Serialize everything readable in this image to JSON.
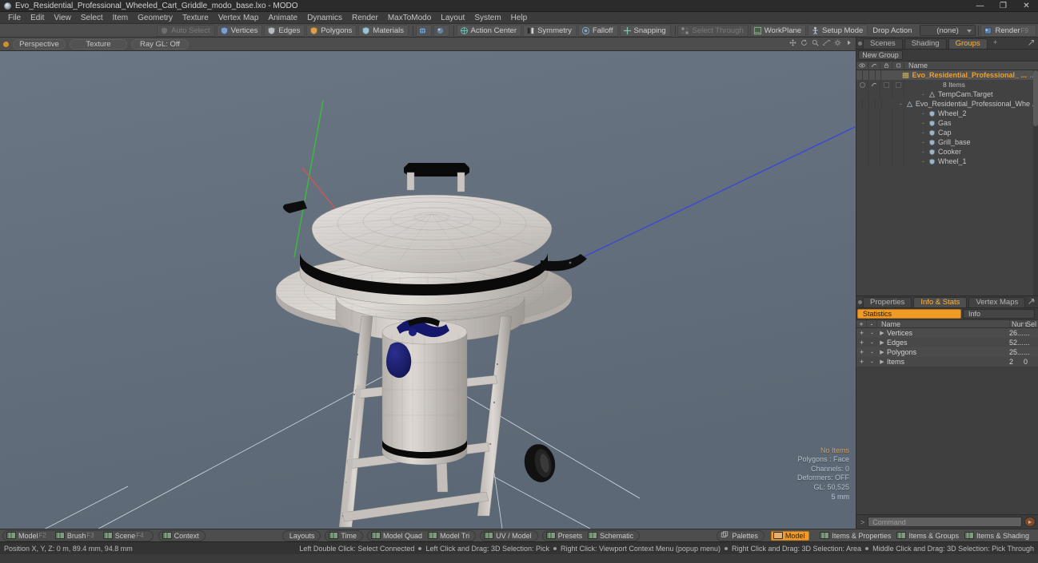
{
  "window": {
    "title": "Evo_Residential_Professional_Wheeled_Cart_Griddle_modo_base.lxo - MODO",
    "minimize": "—",
    "maximize": "❐",
    "close": "✕"
  },
  "menubar": {
    "items": [
      "File",
      "Edit",
      "View",
      "Select",
      "Item",
      "Geometry",
      "Texture",
      "Vertex Map",
      "Animate",
      "Dynamics",
      "Render",
      "MaxToModo",
      "Layout",
      "System",
      "Help"
    ]
  },
  "toolbar": {
    "auto_select": "Auto Select",
    "vertices": "Vertices",
    "edges": "Edges",
    "polygons": "Polygons",
    "materials": "Materials",
    "action_center": "Action Center",
    "symmetry": "Symmetry",
    "falloff": "Falloff",
    "snapping": "Snapping",
    "select_through": "Select Through",
    "workplane": "WorkPlane",
    "setup_mode": "Setup Mode",
    "drop_action_label": "Drop Action",
    "drop_action_value": "(none)",
    "render": "Render",
    "render_key": "F9"
  },
  "viewport": {
    "mode": "Perspective",
    "shading": "Texture",
    "raygl": "Ray GL: Off",
    "overlay": {
      "no_items": "No Items",
      "polygons": "Polygons : Face",
      "channels": "Channels: 0",
      "deformers": "Deformers: OFF",
      "gl": "GL: 50,525",
      "scale": "5 mm"
    }
  },
  "right_panel": {
    "tabs": [
      {
        "label": "Scenes",
        "active": false
      },
      {
        "label": "Shading",
        "active": false
      },
      {
        "label": "Groups",
        "active": true
      },
      {
        "label": "+",
        "active": false
      }
    ],
    "new_group_button": "New Group",
    "tree_header": {
      "name": "Name"
    },
    "tree": [
      {
        "label": "Evo_Residential_Professional_ ...",
        "kind": "group",
        "selected": true,
        "indent": 0,
        "orange": true
      },
      {
        "label": "8 Items",
        "kind": "count",
        "selected": false,
        "indent": 1,
        "orange": false
      },
      {
        "label": "TempCam.Target",
        "kind": "locator",
        "selected": false,
        "indent": 1,
        "orange": false
      },
      {
        "label": "Evo_Residential_Professional_Whe ...",
        "kind": "locator",
        "selected": false,
        "indent": 1,
        "orange": false
      },
      {
        "label": "Wheel_2",
        "kind": "mesh",
        "selected": false,
        "indent": 1,
        "orange": false
      },
      {
        "label": "Gas",
        "kind": "mesh",
        "selected": false,
        "indent": 1,
        "orange": false
      },
      {
        "label": "Cap",
        "kind": "mesh",
        "selected": false,
        "indent": 1,
        "orange": false
      },
      {
        "label": "Grill_base",
        "kind": "mesh",
        "selected": false,
        "indent": 1,
        "orange": false
      },
      {
        "label": "Cooker",
        "kind": "mesh",
        "selected": false,
        "indent": 1,
        "orange": false
      },
      {
        "label": "Wheel_1",
        "kind": "mesh",
        "selected": false,
        "indent": 1,
        "orange": false
      }
    ]
  },
  "stats_panel": {
    "tabs": [
      {
        "label": "Properties",
        "active": false
      },
      {
        "label": "Info & Stats",
        "active": true
      },
      {
        "label": "Vertex Maps",
        "active": false
      },
      {
        "label": "+",
        "active": false
      }
    ],
    "subtabs": [
      {
        "label": "Statistics",
        "active": true
      },
      {
        "label": "Info",
        "active": false
      }
    ],
    "columns": {
      "plus": "+",
      "minus": "-",
      "name": "Name",
      "num": "Num",
      "sel": "Sel"
    },
    "rows": [
      {
        "name": "Vertices",
        "num": "26...",
        "sel": "..."
      },
      {
        "name": "Edges",
        "num": "52...",
        "sel": "..."
      },
      {
        "name": "Polygons",
        "num": "25...",
        "sel": "..."
      },
      {
        "name": "Items",
        "num": "2",
        "sel": "0"
      }
    ]
  },
  "command_bar": {
    "placeholder": "Command",
    "submit": "▸"
  },
  "bottom_bar": {
    "left_group": [
      {
        "label": "Model",
        "fkey": "F2",
        "active": false
      },
      {
        "label": "Brush",
        "fkey": "F3",
        "active": false
      },
      {
        "label": "Scene",
        "fkey": "F4",
        "active": false
      }
    ],
    "context": "Context",
    "center": [
      {
        "label": "Layouts",
        "icon": false
      },
      {
        "label": "Time",
        "icon": true
      },
      {
        "label": "Model Quad",
        "icon": true
      },
      {
        "label": "Model Tri",
        "icon": true
      },
      {
        "label": "UV / Model",
        "icon": true
      },
      {
        "label": "Presets",
        "icon": true
      },
      {
        "label": "Schematic",
        "icon": true
      }
    ],
    "right": [
      {
        "label": "Palettes",
        "active": false
      },
      {
        "label": "Model",
        "active": true
      },
      {
        "label": "Items & Properties",
        "active": false
      },
      {
        "label": "Items & Groups",
        "active": false
      },
      {
        "label": "Items & Shading",
        "active": false
      }
    ]
  },
  "status_bar": {
    "position": "Position X, Y, Z:   0 m, 89.4 mm, 94.8 mm",
    "hints": [
      "Left Double Click: Select Connected",
      "Left Click and Drag: 3D Selection: Pick",
      "Right Click: Viewport Context Menu (popup menu)",
      "Right Click and Drag: 3D Selection: Area",
      "Middle Click and Drag: 3D Selection: Pick Through"
    ]
  },
  "colors": {
    "accent_orange": "#ef9b26",
    "viewport_bg": "#63707d",
    "mesh_light": "#d8d4d0",
    "mesh_dark": "#0a0a0a",
    "gas_blue": "#1b1f72",
    "axis_x": "#d2564f",
    "axis_y": "#3fbf3f",
    "axis_z": "#3a46d8"
  }
}
